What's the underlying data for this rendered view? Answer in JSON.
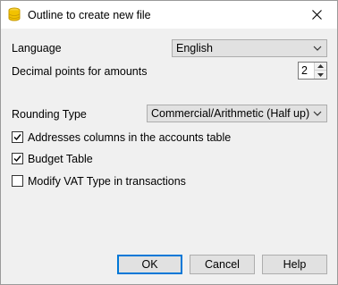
{
  "window": {
    "title": "Outline to create new file",
    "close_symbol": "✕"
  },
  "language": {
    "label": "Language",
    "selected": "English"
  },
  "decimals": {
    "label": "Decimal points for amounts",
    "value": "2"
  },
  "rounding": {
    "label": "Rounding Type",
    "selected": "Commercial/Arithmetic (Half up)"
  },
  "options": [
    {
      "label": "Addresses columns in the accounts table",
      "checked": true
    },
    {
      "label": "Budget Table",
      "checked": true
    },
    {
      "label": "Modify VAT Type in transactions",
      "checked": false
    }
  ],
  "buttons": {
    "ok": "OK",
    "cancel": "Cancel",
    "help": "Help"
  },
  "colors": {
    "accent": "#0078d7",
    "icon_yellow": "#f2c200"
  }
}
